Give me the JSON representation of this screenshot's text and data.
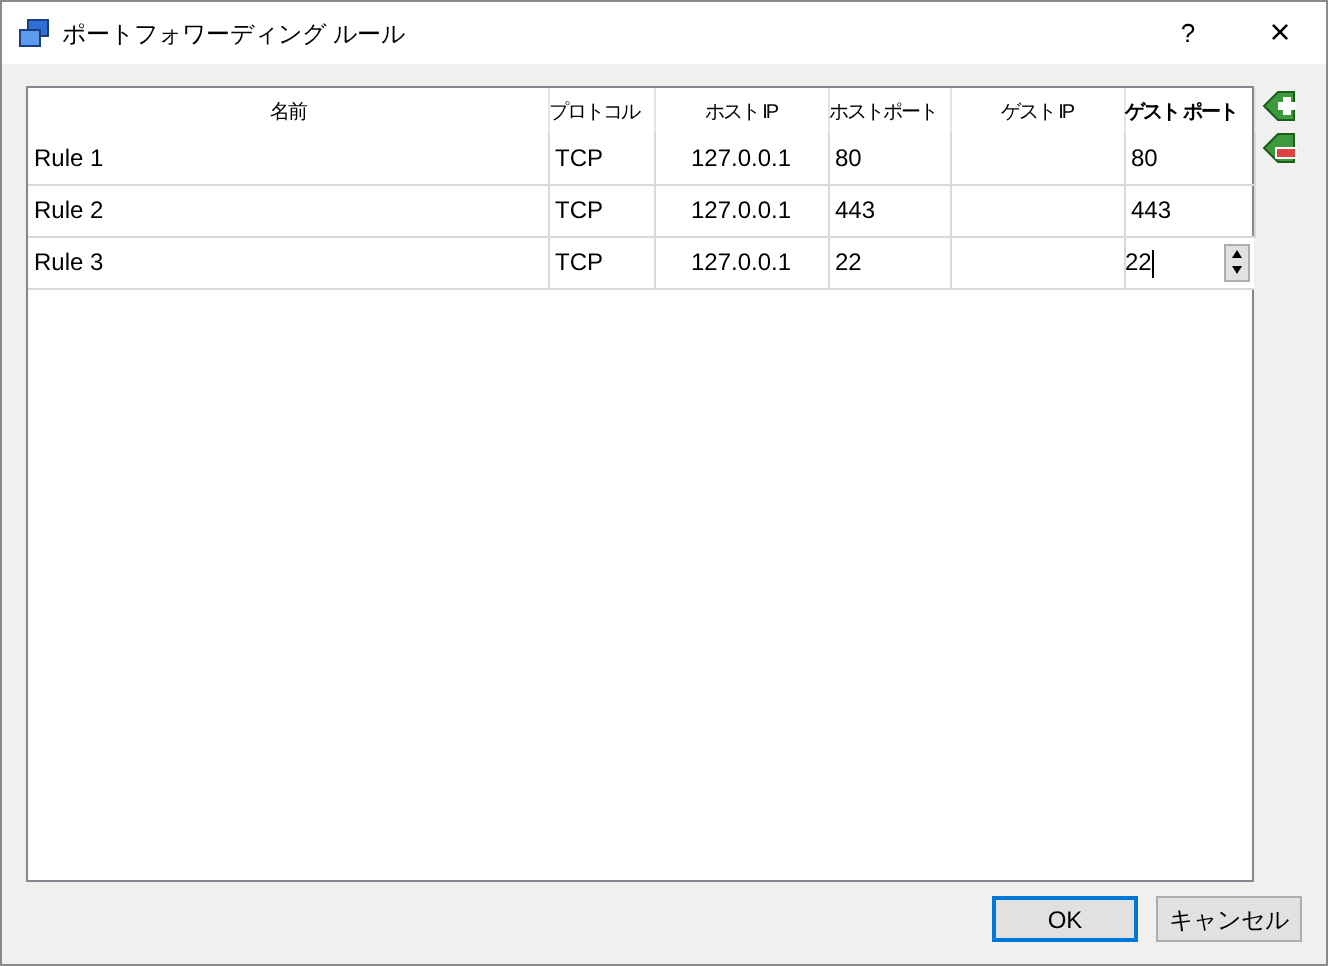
{
  "window": {
    "title": "ポートフォワーディング ルール",
    "help": "?",
    "close": "×"
  },
  "table": {
    "columns": [
      "名前",
      "プロトコル",
      "ホスト IP",
      "ホストポート",
      "ゲスト IP",
      "ゲスト ポート"
    ],
    "rows": [
      {
        "cells": [
          "Rule 1",
          "TCP",
          "127.0.0.1",
          "80",
          "",
          "80"
        ],
        "editing": false
      },
      {
        "cells": [
          "Rule 2",
          "TCP",
          "127.0.0.1",
          "443",
          "",
          "443"
        ],
        "editing": false
      },
      {
        "cells": [
          "Rule 3",
          "TCP",
          "127.0.0.1",
          "22",
          "",
          "22"
        ],
        "editing": true
      }
    ]
  },
  "buttons": [
    {
      "label": "OK",
      "default": true
    },
    {
      "label": "キャンセル",
      "default": false
    }
  ]
}
